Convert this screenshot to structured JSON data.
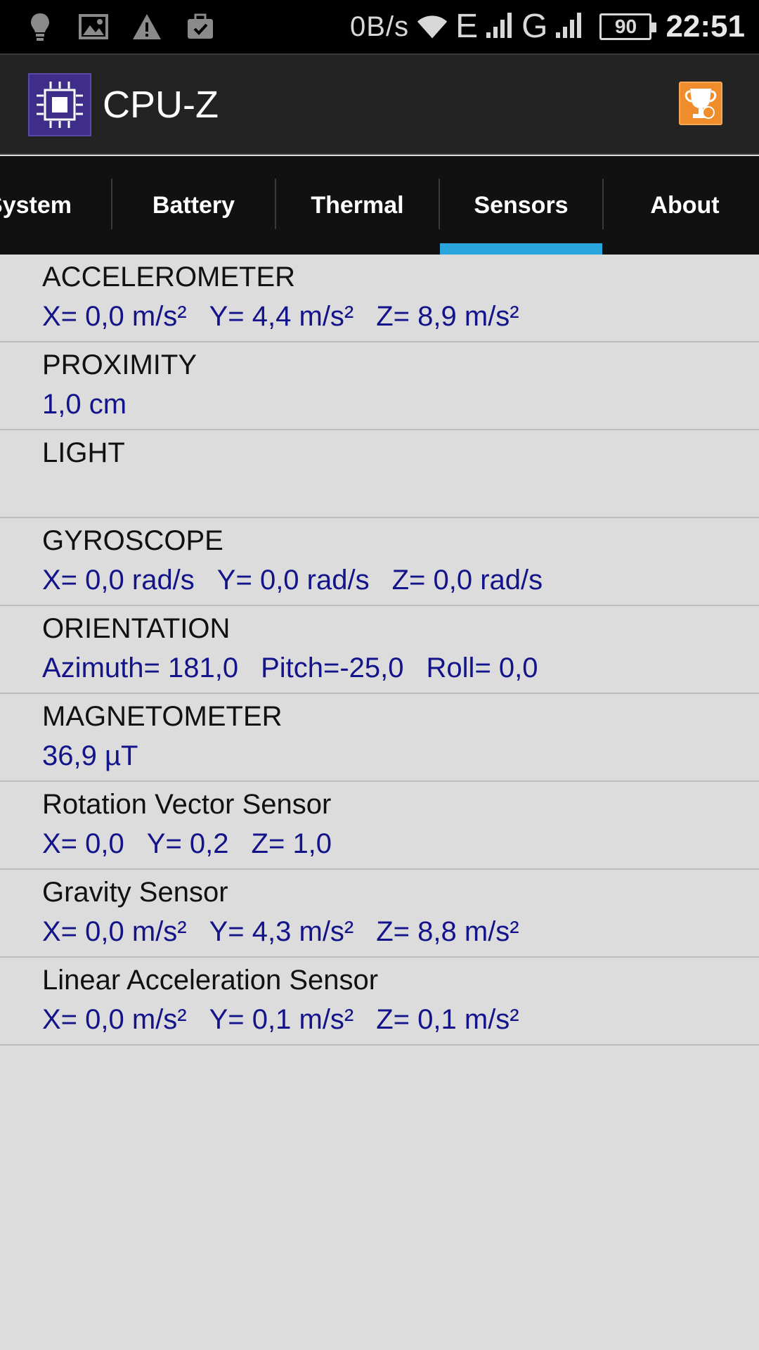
{
  "status_bar": {
    "icons": [
      "lightbulb-icon",
      "image-icon",
      "warning-icon",
      "briefcase-icon"
    ],
    "net_speed": "0B/s",
    "network_1": "E",
    "network_2": "G",
    "battery": "90",
    "time": "22:51"
  },
  "app": {
    "title": "CPU-Z",
    "icon": "cpu-chip-icon",
    "action_icon": "trophy-icon"
  },
  "tabs": [
    {
      "label": "System"
    },
    {
      "label": "Battery"
    },
    {
      "label": "Thermal"
    },
    {
      "label": "Sensors",
      "active": true
    },
    {
      "label": "About"
    }
  ],
  "colors": {
    "accent": "#2aa6dc",
    "value_text": "#13138a",
    "background": "#dcdcdc"
  },
  "sensors": [
    {
      "name": "ACCELEROMETER",
      "values": [
        "X= 0,0 m/s²",
        "Y= 4,4 m/s²",
        "Z= 8,9 m/s²"
      ]
    },
    {
      "name": "PROXIMITY",
      "values": [
        "1,0 cm"
      ]
    },
    {
      "name": "LIGHT",
      "values": []
    },
    {
      "name": "GYROSCOPE",
      "values": [
        "X= 0,0 rad/s",
        "Y= 0,0 rad/s",
        "Z= 0,0 rad/s"
      ]
    },
    {
      "name": "ORIENTATION",
      "values": [
        "Azimuth= 181,0",
        "Pitch=-25,0",
        "Roll= 0,0"
      ]
    },
    {
      "name": "MAGNETOMETER",
      "values": [
        "36,9 µT"
      ]
    },
    {
      "name": "Rotation Vector Sensor",
      "values": [
        "X= 0,0",
        "Y= 0,2",
        "Z= 1,0"
      ]
    },
    {
      "name": "Gravity Sensor",
      "values": [
        "X= 0,0 m/s²",
        "Y= 4,3 m/s²",
        "Z= 8,8 m/s²"
      ]
    },
    {
      "name": "Linear Acceleration Sensor",
      "values": [
        "X= 0,0 m/s²",
        "Y= 0,1 m/s²",
        "Z= 0,1 m/s²"
      ]
    }
  ]
}
